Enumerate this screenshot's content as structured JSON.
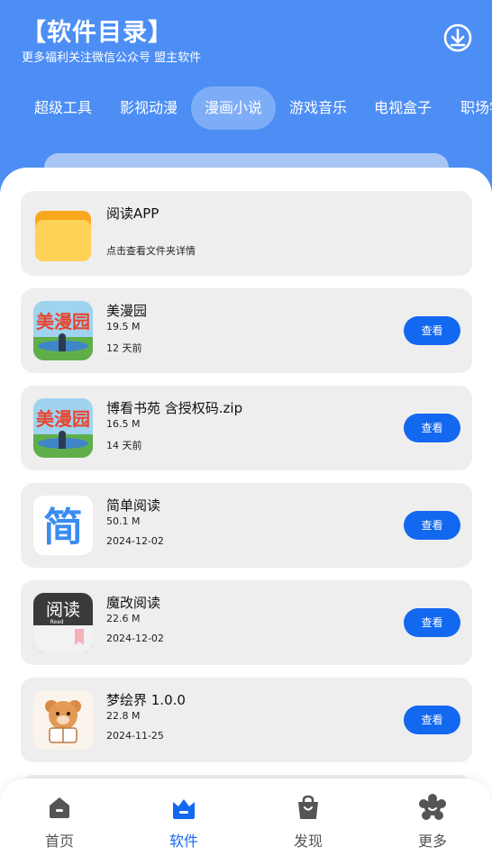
{
  "header": {
    "title": "【软件目录】",
    "subtitle": "更多福利关注微信公众号 盟主软件",
    "download_icon": "download-icon"
  },
  "tabs": [
    {
      "label": "超级工具",
      "active": false
    },
    {
      "label": "影视动漫",
      "active": false
    },
    {
      "label": "漫画小说",
      "active": true
    },
    {
      "label": "游戏音乐",
      "active": false
    },
    {
      "label": "电视盒子",
      "active": false
    },
    {
      "label": "职场学",
      "active": false
    }
  ],
  "colors": {
    "header_blue": "#4d8ef5",
    "button_blue": "#1368f0",
    "card_bg": "#eeeeee"
  },
  "items": [
    {
      "name": "阅读APP",
      "hint": "点击查看文件夹详情",
      "icon": "folder-icon"
    },
    {
      "name": "美漫园",
      "size": "19.5 M",
      "date": "12 天前",
      "button": "查看",
      "icon": "meimanyuan-app-icon"
    },
    {
      "name": "博看书苑 含授权码.zip",
      "size": "16.5 M",
      "date": "14 天前",
      "button": "查看",
      "icon": "meimanyuan-app-icon"
    },
    {
      "name": "简单阅读",
      "size": "50.1 M",
      "date": "2024-12-02",
      "button": "查看",
      "icon": "jian-app-icon",
      "icon_char": "简"
    },
    {
      "name": "魔改阅读",
      "size": "22.6 M",
      "date": "2024-12-02",
      "button": "查看",
      "icon": "yuedu-app-icon",
      "icon_text": "阅读",
      "icon_sub": "Read"
    },
    {
      "name": "梦绘界 1.0.0",
      "size": "22.8 M",
      "date": "2024-11-25",
      "button": "查看",
      "icon": "bear-app-icon"
    }
  ],
  "bottom_nav": [
    {
      "label": "首页",
      "icon": "home-icon",
      "active": false
    },
    {
      "label": "软件",
      "icon": "software-icon",
      "active": true
    },
    {
      "label": "发现",
      "icon": "bag-icon",
      "active": false
    },
    {
      "label": "更多",
      "icon": "flower-icon",
      "active": false
    }
  ],
  "meimanyuan_icon_text": "美漫园"
}
